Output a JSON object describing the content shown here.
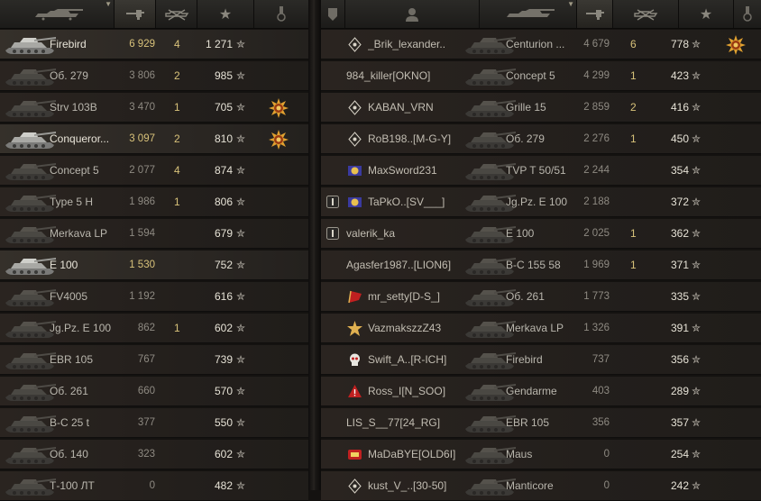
{
  "header_icons": {
    "tank": "tank-icon",
    "damage": "damage-gun-icon",
    "kills": "destroyed-tank-icon",
    "xp": "star-icon",
    "medal": "medal-icon",
    "platoon": "platoon-badge-icon",
    "player": "player-icon"
  },
  "colors": {
    "gold": "#d8c27a",
    "medal_gold": "#e0a030",
    "badge_red": "#c02020"
  },
  "star_glyph": "✮",
  "left_team": [
    {
      "vehicle": "Firebird",
      "damage": "6 929",
      "kills": "4",
      "xp": "1 271",
      "medal": "",
      "highlight": true,
      "gold_damage": true
    },
    {
      "vehicle": "Об. 279",
      "damage": "3 806",
      "kills": "2",
      "xp": "985",
      "medal": "",
      "highlight": false,
      "gold_damage": false
    },
    {
      "vehicle": "Strv 103B",
      "damage": "3 470",
      "kills": "1",
      "xp": "705",
      "medal": "mastery-badge-icon",
      "highlight": false,
      "gold_damage": false
    },
    {
      "vehicle": "Conqueror...",
      "damage": "3 097",
      "kills": "2",
      "xp": "810",
      "medal": "mastery-badge-icon",
      "highlight": true,
      "gold_damage": true
    },
    {
      "vehicle": "Concept 5",
      "damage": "2 077",
      "kills": "4",
      "xp": "874",
      "medal": "",
      "highlight": false,
      "gold_damage": false
    },
    {
      "vehicle": "Type 5 H",
      "damage": "1 986",
      "kills": "1",
      "xp": "806",
      "medal": "",
      "highlight": false,
      "gold_damage": false
    },
    {
      "vehicle": "Merkava LP",
      "damage": "1 594",
      "kills": "",
      "xp": "679",
      "medal": "",
      "highlight": false,
      "gold_damage": false
    },
    {
      "vehicle": "E 100",
      "damage": "1 530",
      "kills": "",
      "xp": "752",
      "medal": "",
      "highlight": true,
      "gold_damage": true
    },
    {
      "vehicle": "FV4005",
      "damage": "1 192",
      "kills": "",
      "xp": "616",
      "medal": "",
      "highlight": false,
      "gold_damage": false
    },
    {
      "vehicle": "Jg.Pz. E 100",
      "damage": "862",
      "kills": "1",
      "xp": "602",
      "medal": "",
      "highlight": false,
      "gold_damage": false
    },
    {
      "vehicle": "EBR 105",
      "damage": "767",
      "kills": "",
      "xp": "739",
      "medal": "",
      "highlight": false,
      "gold_damage": false
    },
    {
      "vehicle": "Об. 261",
      "damage": "660",
      "kills": "",
      "xp": "570",
      "medal": "",
      "highlight": false,
      "gold_damage": false
    },
    {
      "vehicle": "B-C 25 t",
      "damage": "377",
      "kills": "",
      "xp": "550",
      "medal": "",
      "highlight": false,
      "gold_damage": false
    },
    {
      "vehicle": "Об. 140",
      "damage": "323",
      "kills": "",
      "xp": "602",
      "medal": "",
      "highlight": false,
      "gold_damage": false
    },
    {
      "vehicle": "Т-100 ЛТ",
      "damage": "0",
      "kills": "",
      "xp": "482",
      "medal": "",
      "highlight": false,
      "gold_damage": false
    }
  ],
  "right_team": [
    {
      "player": "_Brik_lexander..",
      "vehicle": "Centurion ...",
      "damage": "4 679",
      "kills": "6",
      "xp": "778",
      "medal": "mastery-badge-icon",
      "platoon": "",
      "badge": "diamond-badge-icon"
    },
    {
      "player": "984_killer[OKNO]",
      "vehicle": "Concept 5",
      "damage": "4 299",
      "kills": "1",
      "xp": "423",
      "medal": "",
      "platoon": "",
      "badge": ""
    },
    {
      "player": "KABAN_VRN",
      "vehicle": "Grille 15",
      "damage": "2 859",
      "kills": "2",
      "xp": "416",
      "medal": "",
      "platoon": "",
      "badge": "diamond-badge-icon"
    },
    {
      "player": "RoB198..[M-G-Y]",
      "vehicle": "Об. 279",
      "damage": "2 276",
      "kills": "1",
      "xp": "450",
      "medal": "",
      "platoon": "",
      "badge": "diamond-badge-icon"
    },
    {
      "player": "MaxSword231",
      "vehicle": "TVP T 50/51",
      "damage": "2 244",
      "kills": "",
      "xp": "354",
      "medal": "",
      "platoon": "",
      "badge": "rank-badge-icon"
    },
    {
      "player": "TaPkO..[SV___]",
      "vehicle": "Jg.Pz. E 100",
      "damage": "2 188",
      "kills": "",
      "xp": "372",
      "medal": "",
      "platoon": "platoon-icon",
      "badge": "rank-badge-icon"
    },
    {
      "player": "valerik_ka",
      "vehicle": "E 100",
      "damage": "2 025",
      "kills": "1",
      "xp": "362",
      "medal": "",
      "platoon": "platoon-icon",
      "badge": ""
    },
    {
      "player": "Agasfer1987..[LION6]",
      "vehicle": "B-C 155 58",
      "damage": "1 969",
      "kills": "1",
      "xp": "371",
      "medal": "",
      "platoon": "",
      "badge": ""
    },
    {
      "player": "mr_setty[D-S_]",
      "vehicle": "Об. 261",
      "damage": "1 773",
      "kills": "",
      "xp": "335",
      "medal": "",
      "platoon": "",
      "badge": "flag-badge-icon"
    },
    {
      "player": "VazmakszzZ43",
      "vehicle": "Merkava LP",
      "damage": "1 326",
      "kills": "",
      "xp": "391",
      "medal": "",
      "platoon": "",
      "badge": "star-badge-icon"
    },
    {
      "player": "Swift_A..[R-ICH]",
      "vehicle": "Firebird",
      "damage": "737",
      "kills": "",
      "xp": "356",
      "medal": "",
      "platoon": "",
      "badge": "skull-badge-icon"
    },
    {
      "player": "Ross_I[N_SOO]",
      "vehicle": "Gendarme",
      "damage": "403",
      "kills": "",
      "xp": "289",
      "medal": "",
      "platoon": "",
      "badge": "warning-badge-icon"
    },
    {
      "player": "LIS_S__77[24_RG]",
      "vehicle": "EBR 105",
      "damage": "356",
      "kills": "",
      "xp": "357",
      "medal": "",
      "platoon": "",
      "badge": ""
    },
    {
      "player": "MaDaBYE[OLD6I]",
      "vehicle": "Maus",
      "damage": "0",
      "kills": "",
      "xp": "254",
      "medal": "",
      "platoon": "",
      "badge": "red-badge-icon"
    },
    {
      "player": "kust_V_..[30-50]",
      "vehicle": "Manticore",
      "damage": "0",
      "kills": "",
      "xp": "242",
      "medal": "",
      "platoon": "",
      "badge": "diamond-badge-icon"
    }
  ]
}
